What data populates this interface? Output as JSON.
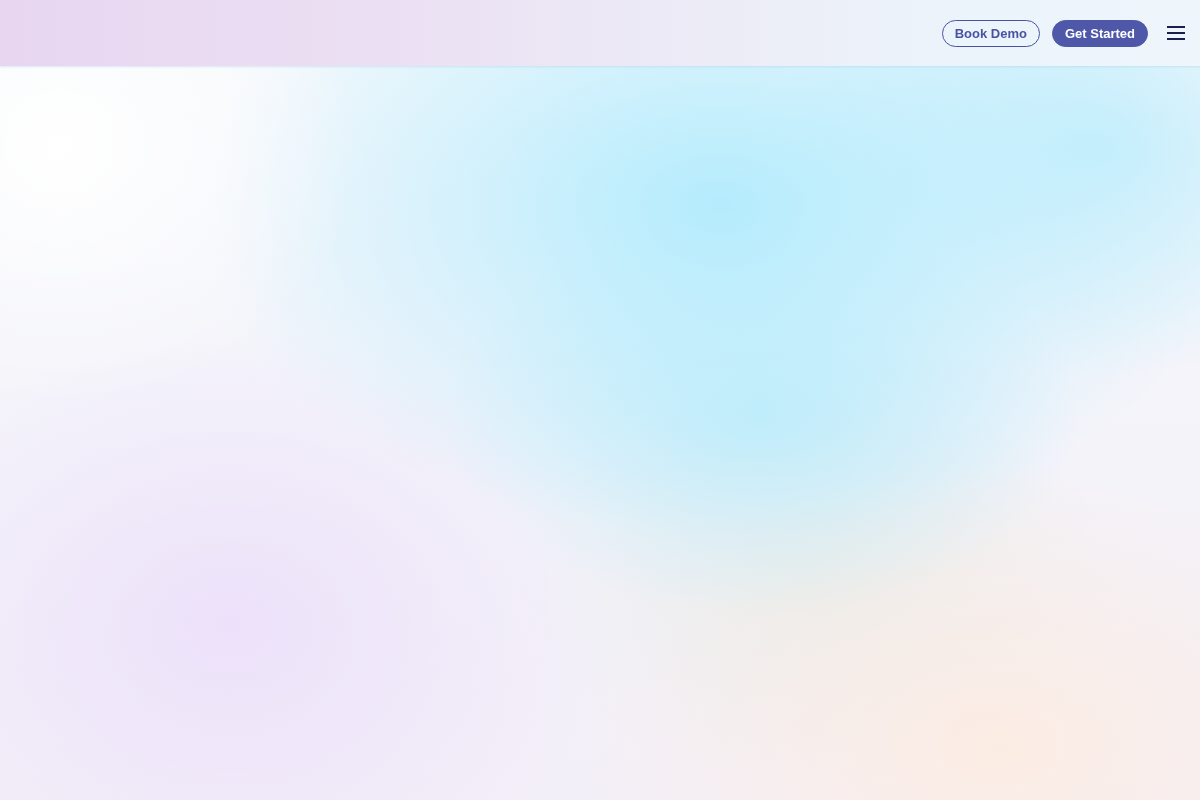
{
  "header": {
    "buttons": [
      {
        "label": "Book Demo",
        "kind": "outline"
      },
      {
        "label": "Get Started",
        "kind": "filled"
      }
    ]
  }
}
